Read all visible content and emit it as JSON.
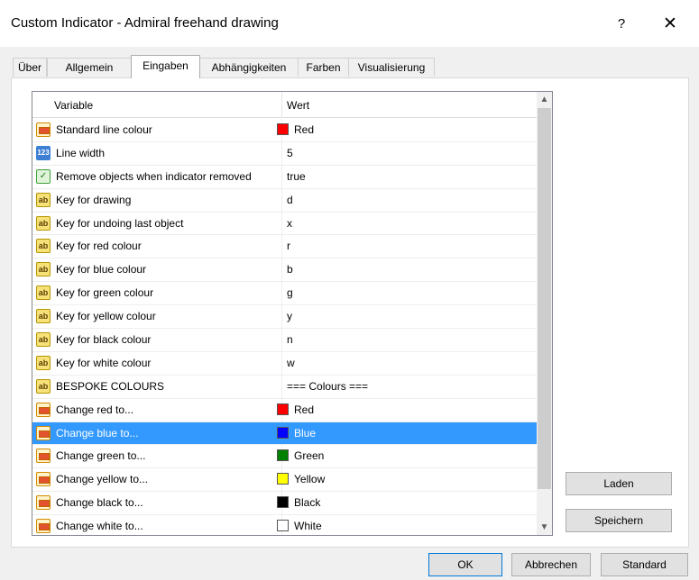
{
  "window": {
    "title": "Custom Indicator - Admiral freehand drawing",
    "help_label": "?",
    "close_label": "✕"
  },
  "tabs": [
    "Über",
    "Allgemein",
    "Eingaben",
    "Abhängigkeiten",
    "Farben",
    "Visualisierung"
  ],
  "active_tab": "Eingaben",
  "grid": {
    "headers": {
      "variable": "Variable",
      "value": "Wert"
    },
    "rows": [
      {
        "icon": "color-icon",
        "name": "Standard line colour",
        "value": "Red",
        "swatch": "#ff0000"
      },
      {
        "icon": "number-icon",
        "icon_text": "123",
        "name": "Line width",
        "value": "5"
      },
      {
        "icon": "bool-icon",
        "icon_text": "✓",
        "name": "Remove objects when indicator removed",
        "value": "true"
      },
      {
        "icon": "string-icon",
        "icon_text": "ab",
        "name": "Key for drawing",
        "value": "d"
      },
      {
        "icon": "string-icon",
        "icon_text": "ab",
        "name": "Key for undoing last object",
        "value": "x"
      },
      {
        "icon": "string-icon",
        "icon_text": "ab",
        "name": "Key for red colour",
        "value": "r"
      },
      {
        "icon": "string-icon",
        "icon_text": "ab",
        "name": "Key for blue colour",
        "value": "b"
      },
      {
        "icon": "string-icon",
        "icon_text": "ab",
        "name": "Key for green colour",
        "value": "g"
      },
      {
        "icon": "string-icon",
        "icon_text": "ab",
        "name": "Key for yellow colour",
        "value": "y"
      },
      {
        "icon": "string-icon",
        "icon_text": "ab",
        "name": "Key for black colour",
        "value": "n"
      },
      {
        "icon": "string-icon",
        "icon_text": "ab",
        "name": "Key for white colour",
        "value": "w"
      },
      {
        "icon": "string-icon",
        "icon_text": "ab",
        "name": "BESPOKE COLOURS",
        "value": "=== Colours ==="
      },
      {
        "icon": "color-icon",
        "name": "Change red to...",
        "value": "Red",
        "swatch": "#ff0000"
      },
      {
        "icon": "color-icon",
        "name": "Change blue to...",
        "value": "Blue",
        "swatch": "#0000ff",
        "selected": true
      },
      {
        "icon": "color-icon",
        "name": "Change green to...",
        "value": "Green",
        "swatch": "#008000"
      },
      {
        "icon": "color-icon",
        "name": "Change yellow to...",
        "value": "Yellow",
        "swatch": "#ffff00"
      },
      {
        "icon": "color-icon",
        "name": "Change black to...",
        "value": "Black",
        "swatch": "#000000"
      },
      {
        "icon": "color-icon",
        "name": "Change white to...",
        "value": "White",
        "swatch": "#ffffff"
      }
    ]
  },
  "side_buttons": {
    "load": "Laden",
    "save": "Speichern"
  },
  "footer_buttons": {
    "ok": "OK",
    "cancel": "Abbrechen",
    "default": "Standard"
  },
  "colors": {
    "selection": "#3399ff",
    "default_button_border": "#0078d7"
  }
}
